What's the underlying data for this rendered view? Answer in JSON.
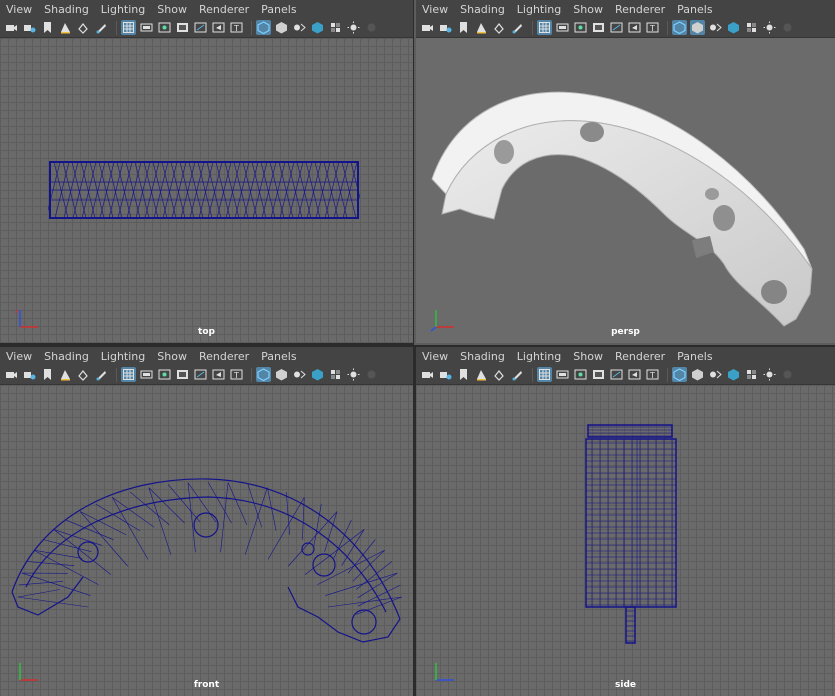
{
  "menu": [
    "View",
    "Shading",
    "Lighting",
    "Show",
    "Renderer",
    "Panels"
  ],
  "viewports": {
    "top": {
      "label": "top"
    },
    "persp": {
      "label": "persp"
    },
    "front": {
      "label": "front"
    },
    "side": {
      "label": "side"
    }
  },
  "colors": {
    "wire": "#14148a",
    "grid": "#5d5d5d",
    "viewport_bg": "#6a6a6a",
    "ui_bg": "#444444",
    "accent": "#5285a6"
  },
  "icons": [
    "camera-icon",
    "camera-attr-icon",
    "bookmark-icon",
    "image-plane-icon",
    "2d-pan-icon",
    "grease-pencil-icon",
    "grid-icon",
    "film-gate-icon",
    "resolution-gate-icon",
    "gate-mask-icon",
    "field-chart-icon",
    "safe-action-icon",
    "safe-title-icon",
    "wireframe-icon",
    "smooth-shade-icon",
    "lighting-icon",
    "textured-icon",
    "shadows-icon",
    "ambient-occlusion-icon",
    "light-icon"
  ]
}
